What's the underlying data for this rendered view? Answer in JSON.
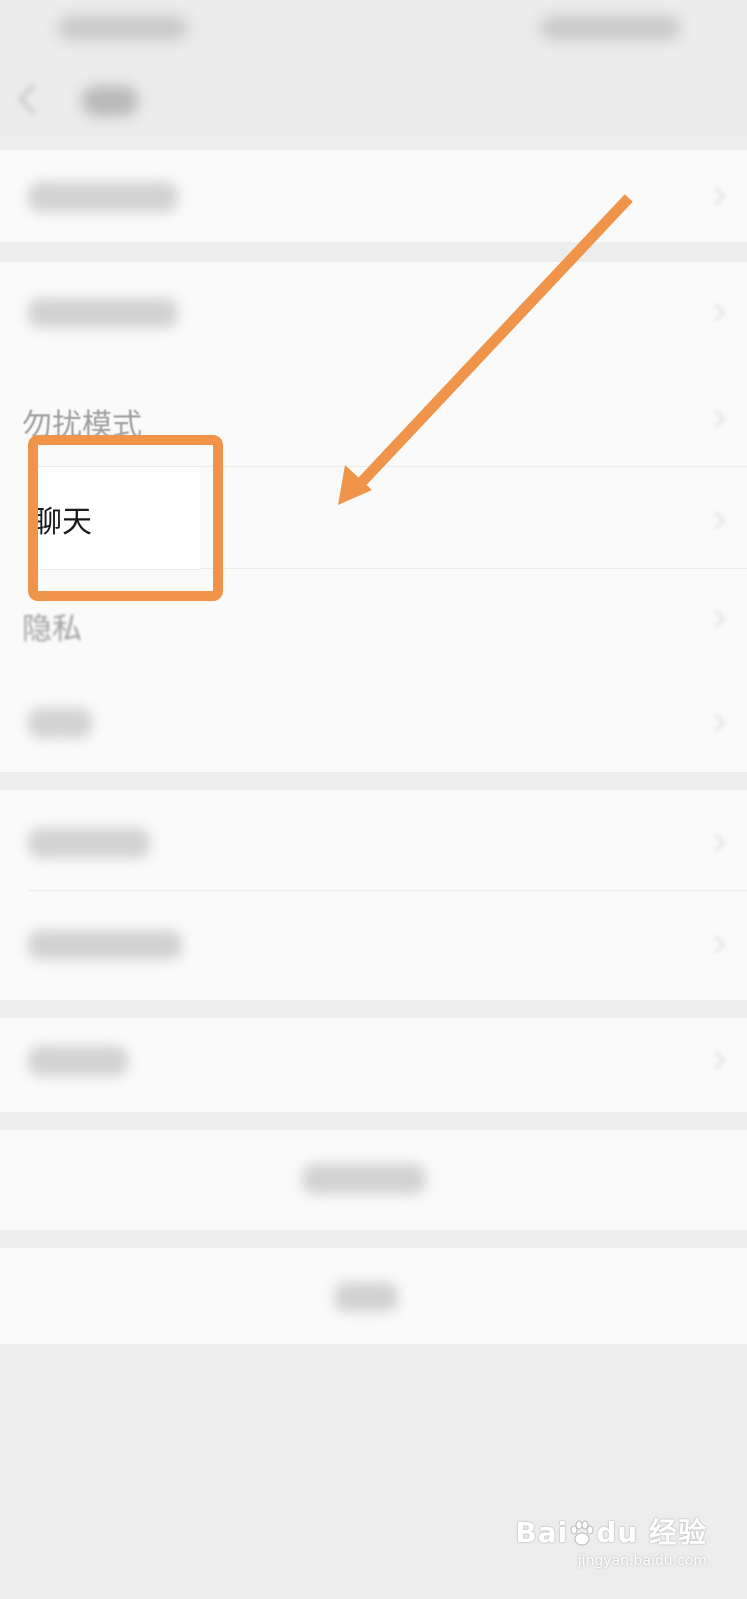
{
  "settings": {
    "rows": [
      {
        "label": "勿扰模式",
        "visible_text": "勿扰模式"
      },
      {
        "label": "聊天",
        "visible_text": "聊天"
      },
      {
        "label": "隐私",
        "visible_text": "隐私"
      }
    ]
  },
  "annotation": {
    "color": "#f0944a"
  },
  "watermark": {
    "logo_text": "Bai",
    "logo_text_2": "du",
    "logo_suffix": "经验",
    "url": "jingyan.baidu.com"
  }
}
